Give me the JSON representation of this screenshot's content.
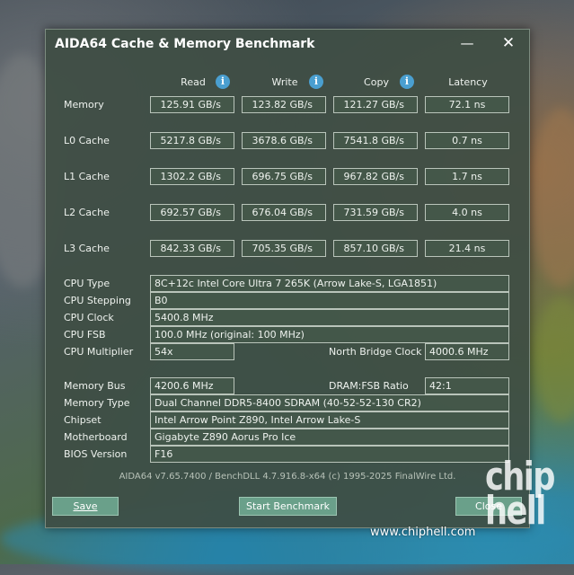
{
  "window": {
    "title": "AIDA64 Cache & Memory Benchmark",
    "minimize_glyph": "—",
    "close_glyph": "✕"
  },
  "columns": {
    "read": "Read",
    "write": "Write",
    "copy": "Copy",
    "latency": "Latency",
    "info_glyph": "i"
  },
  "bench": [
    {
      "label": "Memory",
      "read": "125.91 GB/s",
      "write": "123.82 GB/s",
      "copy": "121.27 GB/s",
      "latency": "72.1 ns"
    },
    {
      "label": "L0 Cache",
      "read": "5217.8 GB/s",
      "write": "3678.6 GB/s",
      "copy": "7541.8 GB/s",
      "latency": "0.7 ns"
    },
    {
      "label": "L1 Cache",
      "read": "1302.2 GB/s",
      "write": "696.75 GB/s",
      "copy": "967.82 GB/s",
      "latency": "1.7 ns"
    },
    {
      "label": "L2 Cache",
      "read": "692.57 GB/s",
      "write": "676.04 GB/s",
      "copy": "731.59 GB/s",
      "latency": "4.0 ns"
    },
    {
      "label": "L3 Cache",
      "read": "842.33 GB/s",
      "write": "705.35 GB/s",
      "copy": "857.10 GB/s",
      "latency": "21.4 ns"
    }
  ],
  "cpu": {
    "type_label": "CPU Type",
    "type_value": "8C+12c Intel Core Ultra 7 265K  (Arrow Lake-S, LGA1851)",
    "stepping_label": "CPU Stepping",
    "stepping_value": "B0",
    "clock_label": "CPU Clock",
    "clock_value": "5400.8 MHz",
    "fsb_label": "CPU FSB",
    "fsb_value": "100.0 MHz  (original: 100 MHz)",
    "multiplier_label": "CPU Multiplier",
    "multiplier_value": "54x",
    "nb_clock_label": "North Bridge Clock",
    "nb_clock_value": "4000.6 MHz"
  },
  "memory": {
    "bus_label": "Memory Bus",
    "bus_value": "4200.6 MHz",
    "ratio_label": "DRAM:FSB Ratio",
    "ratio_value": "42:1",
    "type_label": "Memory Type",
    "type_value": "Dual Channel DDR5-8400 SDRAM  (40-52-52-130 CR2)",
    "chipset_label": "Chipset",
    "chipset_value": "Intel Arrow Point Z890, Intel Arrow Lake-S",
    "motherboard_label": "Motherboard",
    "motherboard_value": "Gigabyte Z890 Aorus Pro Ice",
    "bios_label": "BIOS Version",
    "bios_value": "F16"
  },
  "footer": "AIDA64 v7.65.7400 / BenchDLL 4.7.916.8-x64  (c) 1995-2025 FinalWire Ltd.",
  "buttons": {
    "save": "Save",
    "start": "Start Benchmark",
    "close": "Close"
  },
  "watermark": {
    "logo_text": "chip hell",
    "url": "www.chiphell.com"
  }
}
